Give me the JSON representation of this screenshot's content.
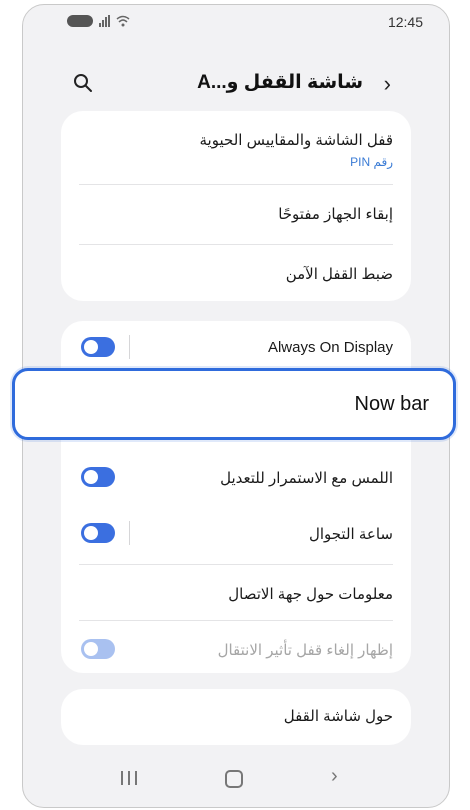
{
  "status_bar": {
    "time": "12:45"
  },
  "header": {
    "title": "شاشة القفل و...A",
    "back_icon": "chevron-right-icon",
    "search_icon": "search-icon"
  },
  "card1": {
    "items": [
      {
        "label": "قفل الشاشة والمقاييس الحيوية",
        "sub": "رقم PIN"
      },
      {
        "label": "إبقاء الجهاز مفتوحًا"
      },
      {
        "label": "ضبط القفل الآمن"
      }
    ]
  },
  "card2": {
    "always_on": {
      "label": "Always On Display",
      "toggle": "on"
    },
    "now_bar": {
      "label": "Now bar"
    },
    "touch_hold": {
      "label": "اللمس مع الاستمرار للتعديل",
      "toggle": "on"
    },
    "roaming_clock": {
      "label": "ساعة التجوال",
      "toggle": "on"
    },
    "contact_info": {
      "label": "معلومات حول جهة الاتصال"
    },
    "unlock_effect": {
      "label": "إظهار إلغاء قفل تأثير الانتقال",
      "toggle": "on-disabled"
    }
  },
  "card3": {
    "about": "حول شاشة القفل"
  },
  "colors": {
    "accent": "#3b6fe0",
    "link": "#3a7bd5",
    "highlight_border": "#2f6bdc"
  }
}
